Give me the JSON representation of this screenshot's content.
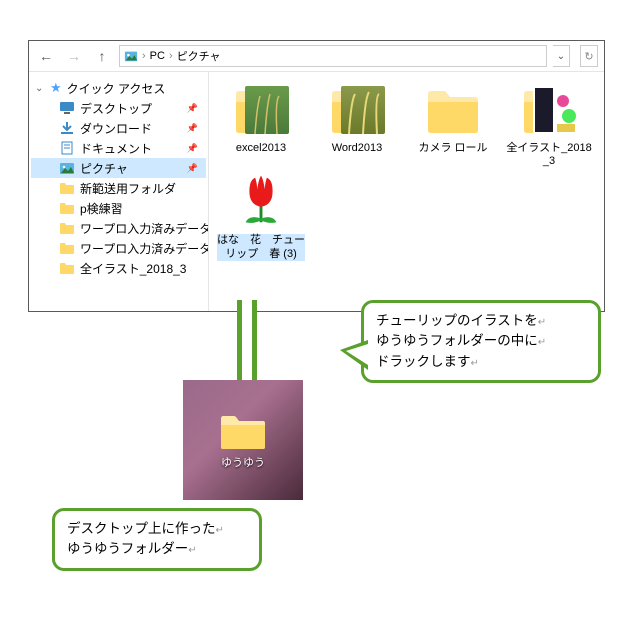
{
  "breadcrumb": {
    "root": "PC",
    "current": "ピクチャ"
  },
  "nav": {
    "quick_access": "クイック アクセス",
    "items": [
      {
        "label": "デスクトップ",
        "pinned": true,
        "kind": "desktop"
      },
      {
        "label": "ダウンロード",
        "pinned": true,
        "kind": "downloads"
      },
      {
        "label": "ドキュメント",
        "pinned": true,
        "kind": "documents"
      },
      {
        "label": "ピクチャ",
        "pinned": true,
        "kind": "pictures",
        "selected": true
      },
      {
        "label": "新範送用フォルダ",
        "kind": "folder"
      },
      {
        "label": "p検練習",
        "kind": "folder"
      },
      {
        "label": "ワープロ入力済みデータ",
        "kind": "folder"
      },
      {
        "label": "ワープロ入力済みデータ",
        "kind": "folder"
      },
      {
        "label": "全イラスト_2018_3",
        "kind": "folder"
      }
    ]
  },
  "items": [
    {
      "label": "excel2013",
      "preview": "wheat-green"
    },
    {
      "label": "Word2013",
      "preview": "wheat-yellow"
    },
    {
      "label": "カメラ ロール",
      "preview": ""
    },
    {
      "label": "全イラスト_2018_3",
      "preview": "clipart"
    },
    {
      "label": "はな　花　チューリップ　春 (3)",
      "preview": "tulip",
      "selected": true
    }
  ],
  "desktop_folder": "ゆうゆう",
  "callout1": {
    "l1": "チューリップのイラストを",
    "l2": "ゆうゆうフォルダーの中に",
    "l3": "ドラックします"
  },
  "callout2": {
    "l1": "デスクトップ上に作った",
    "l2": "ゆうゆうフォルダー"
  }
}
